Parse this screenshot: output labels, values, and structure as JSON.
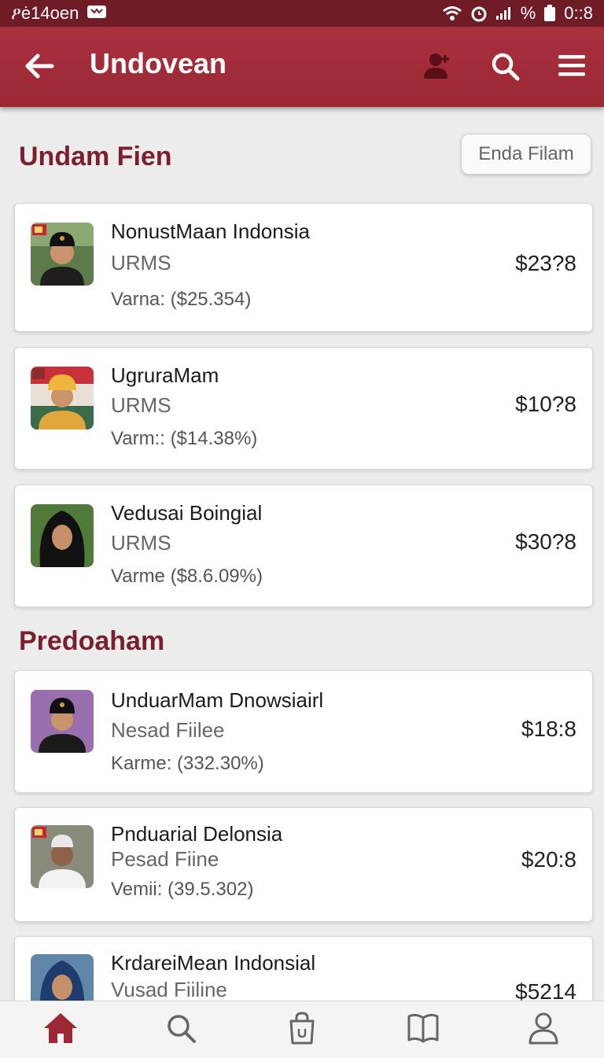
{
  "status_bar": {
    "left_text": "ዖė14oen",
    "right_text": "0::8",
    "percent": "%"
  },
  "app_bar": {
    "title": "Undovean"
  },
  "sections": [
    {
      "title": "Undam Fien",
      "filter_label": "Enda Filam",
      "items": [
        {
          "name": "NonustMaan Indonsia",
          "sub": "URMS",
          "meta": "Varna: ($25.354)",
          "price": "$23?8"
        },
        {
          "name": "UgruraMam",
          "sub": "URMS",
          "meta": "Varm:: ($14.38%)",
          "price": "$10?8"
        },
        {
          "name": "Vedusai Boingial",
          "sub": "URMS",
          "meta": "Varme ($8.6.09%)",
          "price": "$30?8"
        }
      ]
    },
    {
      "title": "Predoaham",
      "items": [
        {
          "name": "UnduarMam Dnowsiairl",
          "sub": "Nesad Fiilee",
          "meta": "Karme: (332.30%)",
          "price": "$18:8"
        },
        {
          "name": "Pnduarial Delonsia",
          "sub": "Pesad Fiine",
          "meta": "Vemii: (39.5.302)",
          "price": "$20:8"
        },
        {
          "name": "KrdareiMean Indonsial",
          "sub": "Vusad Fiiline",
          "meta": "",
          "price": "$5214"
        }
      ]
    }
  ]
}
